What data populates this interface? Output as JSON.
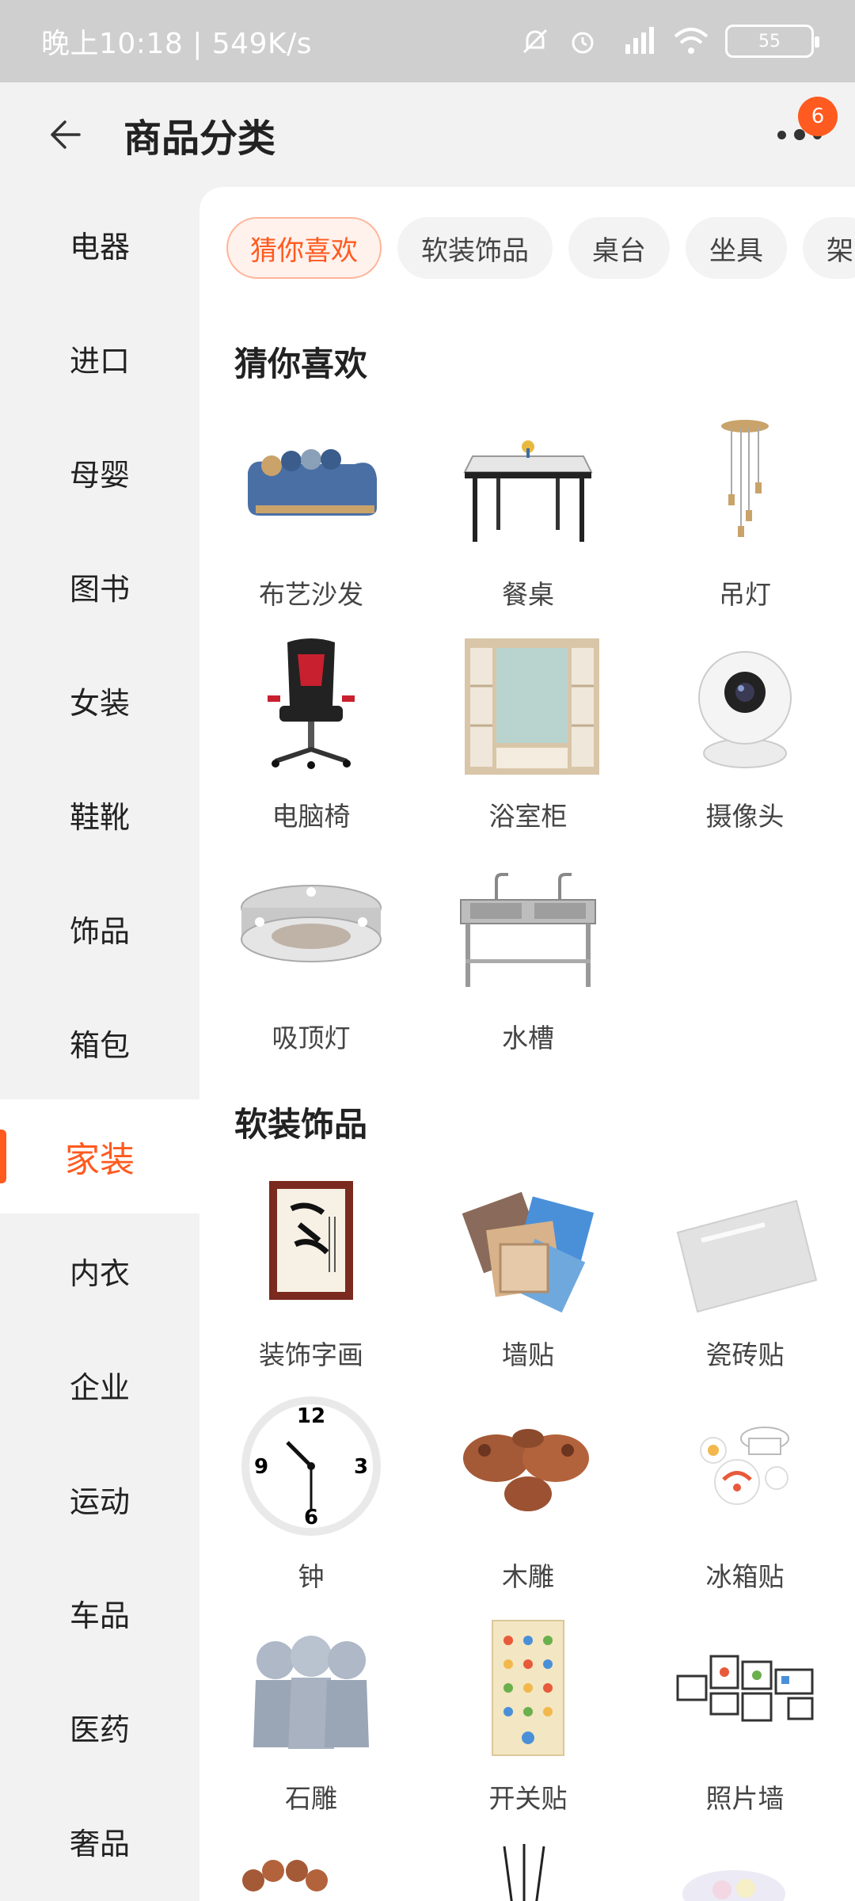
{
  "status_bar": {
    "time": "晚上10:18 | 549K/s",
    "battery": "55"
  },
  "header": {
    "title": "商品分类",
    "badge": "6"
  },
  "sidebar": {
    "items": [
      {
        "label": "电器"
      },
      {
        "label": "进口"
      },
      {
        "label": "母婴"
      },
      {
        "label": "图书"
      },
      {
        "label": "女装"
      },
      {
        "label": "鞋靴"
      },
      {
        "label": "饰品"
      },
      {
        "label": "箱包"
      },
      {
        "label": "家装"
      },
      {
        "label": "内衣"
      },
      {
        "label": "企业"
      },
      {
        "label": "运动"
      },
      {
        "label": "车品"
      },
      {
        "label": "医药"
      },
      {
        "label": "奢品"
      }
    ],
    "active": "家装"
  },
  "tabs": [
    {
      "label": "猜你喜欢"
    },
    {
      "label": "软装饰品"
    },
    {
      "label": "桌台"
    },
    {
      "label": "坐具"
    },
    {
      "label": "架"
    }
  ],
  "sections": [
    {
      "title": "猜你喜欢",
      "items": [
        {
          "label": "布艺沙发",
          "icon": "sofa-icon"
        },
        {
          "label": "餐桌",
          "icon": "dining-table-icon"
        },
        {
          "label": "吊灯",
          "icon": "pendant-lamp-icon"
        },
        {
          "label": "电脑椅",
          "icon": "office-chair-icon"
        },
        {
          "label": "浴室柜",
          "icon": "bathroom-cabinet-icon"
        },
        {
          "label": "摄像头",
          "icon": "camera-icon"
        },
        {
          "label": "吸顶灯",
          "icon": "ceiling-lamp-icon"
        },
        {
          "label": "水槽",
          "icon": "sink-icon"
        }
      ]
    },
    {
      "title": "软装饰品",
      "items": [
        {
          "label": "装饰字画",
          "icon": "calligraphy-icon"
        },
        {
          "label": "墙贴",
          "icon": "wall-sticker-icon"
        },
        {
          "label": "瓷砖贴",
          "icon": "tile-sticker-icon"
        },
        {
          "label": "钟",
          "icon": "clock-icon"
        },
        {
          "label": "木雕",
          "icon": "wood-carving-icon"
        },
        {
          "label": "冰箱贴",
          "icon": "fridge-magnet-icon"
        },
        {
          "label": "石雕",
          "icon": "stone-carving-icon"
        },
        {
          "label": "开关贴",
          "icon": "switch-sticker-icon"
        },
        {
          "label": "照片墙",
          "icon": "photo-wall-icon"
        }
      ]
    }
  ]
}
